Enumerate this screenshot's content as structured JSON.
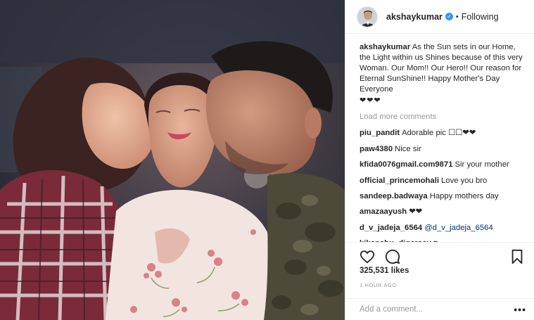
{
  "post": {
    "photo": {
      "label": "post-photo"
    },
    "header": {
      "username": "akshaykumar",
      "verified_icon": "verified-check-icon",
      "separator": "•",
      "follow_status": "Following"
    },
    "caption": {
      "username": "akshaykumar",
      "text": "As the Sun sets in our Home, the Light within us Shines because of this very Woman. Our Mom!! Our Hero!! Our reason for Eternal SunShine!! Happy Mother's Day Everyone",
      "hearts": "❤❤❤"
    },
    "load_more": "Load more comments",
    "comments": [
      {
        "user": "piu_pandit",
        "text": "Adorable pic ☐☐❤❤",
        "mention": ""
      },
      {
        "user": "paw4380",
        "text": "Nice sir",
        "mention": ""
      },
      {
        "user": "kfida0076gmail.com9871",
        "text": "Sir your mother",
        "mention": ""
      },
      {
        "user": "official_princemohali",
        "text": "Love you bro",
        "mention": ""
      },
      {
        "user": "sandeep.badwaya",
        "text": "Happy mothers day",
        "mention": ""
      },
      {
        "user": "amazaayush",
        "text": "❤❤",
        "mention": ""
      },
      {
        "user": "d_v_jadeja_6564",
        "text": "",
        "mention": "@d_v_jadeja_6564"
      },
      {
        "user": "kikanshu_digarsey",
        "text": "♥",
        "mention": ""
      }
    ],
    "actions": {
      "like_icon": "heart-outline-icon",
      "comment_icon": "comment-bubble-icon",
      "save_icon": "bookmark-icon"
    },
    "likes": "325,531 likes",
    "timestamp": "1 HOUR AGO",
    "add_comment": {
      "placeholder": "Add a comment...",
      "more_icon": "more-options-icon",
      "more_label": "•••"
    }
  },
  "colors": {
    "text": "#262626",
    "muted": "#999999",
    "verified": "#3897f0",
    "divider": "#efefef",
    "mention": "#003569"
  }
}
